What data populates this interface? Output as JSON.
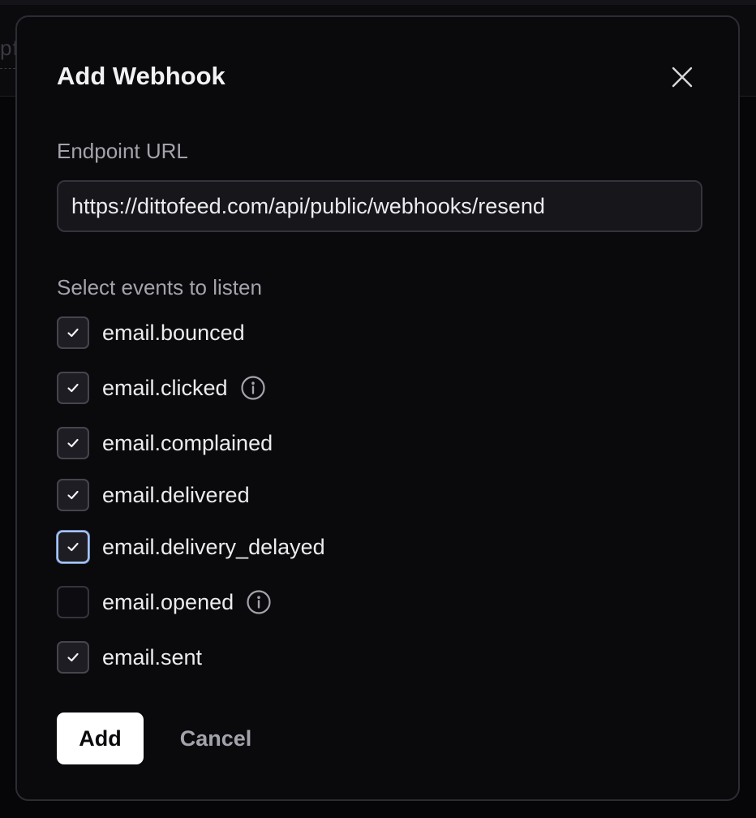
{
  "backdrop": {
    "fragment_text": "pf"
  },
  "dialog": {
    "title": "Add Webhook",
    "close_icon": "close-icon"
  },
  "endpoint": {
    "label": "Endpoint URL",
    "value": "https://dittofeed.com/api/public/webhooks/resend"
  },
  "events": {
    "label": "Select events to listen",
    "items": [
      {
        "label": "email.bounced",
        "checked": true,
        "info": false,
        "focused": false
      },
      {
        "label": "email.clicked",
        "checked": true,
        "info": true,
        "focused": false
      },
      {
        "label": "email.complained",
        "checked": true,
        "info": false,
        "focused": false
      },
      {
        "label": "email.delivered",
        "checked": true,
        "info": false,
        "focused": false
      },
      {
        "label": "email.delivery_delayed",
        "checked": true,
        "info": false,
        "focused": true
      },
      {
        "label": "email.opened",
        "checked": false,
        "info": true,
        "focused": false
      },
      {
        "label": "email.sent",
        "checked": true,
        "info": false,
        "focused": false
      }
    ]
  },
  "actions": {
    "add_label": "Add",
    "cancel_label": "Cancel"
  },
  "colors": {
    "background": "#0a0a0d",
    "text": "#ececef",
    "muted": "#a3a3ab",
    "focus_ring": "#a9c5f0",
    "primary_button": "#ffffff"
  }
}
